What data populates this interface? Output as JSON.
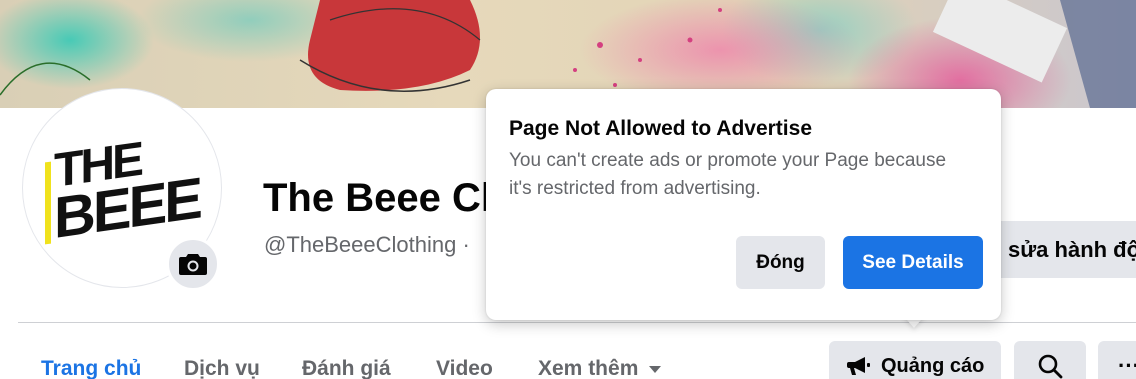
{
  "profile": {
    "name": "The Beee Cl",
    "handle": "@TheBeeeClothing ·",
    "logo_line1": "THE",
    "logo_line2": "BEEE"
  },
  "header_actions": {
    "edit_action_label": "sửa hành độ"
  },
  "tabs": [
    {
      "label": "Trang chủ",
      "active": true
    },
    {
      "label": "Dịch vụ",
      "active": false
    },
    {
      "label": "Đánh giá",
      "active": false
    },
    {
      "label": "Video",
      "active": false
    },
    {
      "label": "Xem thêm",
      "active": false
    }
  ],
  "toolbar": {
    "ads_label": "Quảng cáo",
    "more_label": "···"
  },
  "popover": {
    "title": "Page Not Allowed to Advertise",
    "body": "You can't create ads or promote your Page because it's restricted from advertising.",
    "close_label": "Đóng",
    "details_label": "See Details"
  },
  "colors": {
    "accent": "#1b74e4",
    "button_gray": "#e4e6eb",
    "secondary_text": "#65676b",
    "logo_yellow": "#f0e21d"
  },
  "icons": {
    "camera": "camera-icon",
    "megaphone": "megaphone-icon",
    "search": "search-icon",
    "dropdown": "caret-down-icon"
  }
}
